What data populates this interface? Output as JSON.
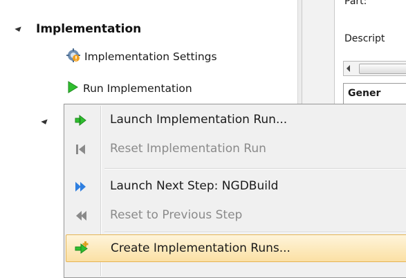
{
  "navigator": {
    "section_label": "Implementation",
    "items": [
      {
        "label": "Implementation Settings",
        "icon": "gear-icon"
      },
      {
        "label": "Run Implementation",
        "icon": "run-play-icon"
      }
    ]
  },
  "properties": {
    "part_label": "Part:",
    "description_label": "Descript",
    "tab_label": "Gener"
  },
  "context_menu": {
    "items": [
      {
        "label": "Launch Implementation Run...",
        "enabled": true,
        "icon": "launch-run-icon"
      },
      {
        "label": "Reset Implementation Run",
        "enabled": false,
        "icon": "reset-run-icon"
      },
      {
        "label": "Launch Next Step: NGDBuild",
        "enabled": true,
        "icon": "next-step-icon"
      },
      {
        "label": "Reset to Previous Step",
        "enabled": false,
        "icon": "previous-step-icon"
      },
      {
        "label": "Create Implementation Runs...",
        "enabled": true,
        "highlighted": true,
        "icon": "create-runs-icon"
      }
    ]
  },
  "colors": {
    "highlight_fill": "#fbe0a4",
    "highlight_border": "#e5b453",
    "disabled_text": "#8a8a8a",
    "play_green": "#2fbf2f",
    "next_blue": "#2f7fe0"
  }
}
